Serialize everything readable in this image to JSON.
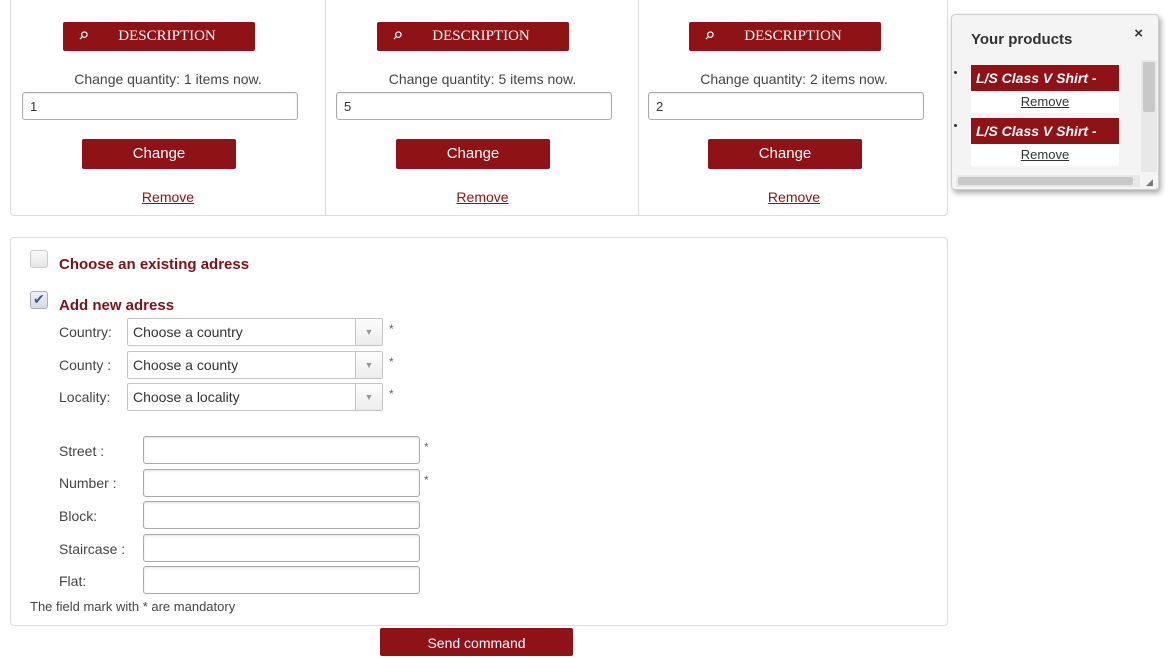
{
  "cart": {
    "items": [
      {
        "description_label": "DESCRIPTION",
        "quantity_label": "Change quantity: 1 items now.",
        "quantity_value": "1",
        "change_label": "Change",
        "remove_label": "Remove"
      },
      {
        "description_label": "DESCRIPTION",
        "quantity_label": "Change quantity: 5 items now.",
        "quantity_value": "5",
        "change_label": "Change",
        "remove_label": "Remove"
      },
      {
        "description_label": "DESCRIPTION",
        "quantity_label": "Change quantity: 2 items now.",
        "quantity_value": "2",
        "change_label": "Change",
        "remove_label": "Remove"
      }
    ]
  },
  "products_popup": {
    "title": "Your products",
    "close_icon": "×",
    "products": [
      {
        "name": "L/S Class V Shirt -",
        "remove_label": "Remove"
      },
      {
        "name": "L/S Class V Shirt -",
        "remove_label": "Remove"
      }
    ]
  },
  "address": {
    "existing_label": "Choose an existing adress",
    "existing_checked": false,
    "new_label": "Add new adress",
    "new_checked": true,
    "country_label": "Country:",
    "country_value": "Choose a country",
    "county_label": "County :",
    "county_value": "Choose a county",
    "locality_label": "Locality:",
    "locality_value": "Choose a locality",
    "street_label": "Street :",
    "number_label": "Number :",
    "block_label": "Block:",
    "staircase_label": "Staircase :",
    "flat_label": "Flat:",
    "required_mark": "*",
    "mandatory_note": "The field mark with * are mandatory"
  },
  "send_label": "Send command",
  "colors": {
    "accent": "#8e1216",
    "label_red": "#7f1116"
  }
}
